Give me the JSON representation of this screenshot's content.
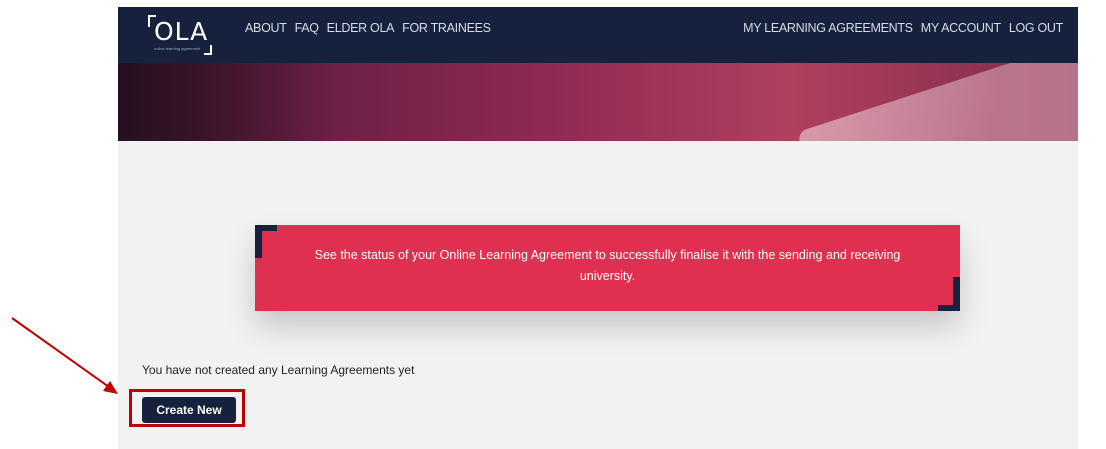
{
  "logo": {
    "text": "OLA",
    "tagline": "online learning agreement"
  },
  "nav_left": [
    "ABOUT",
    "FAQ",
    "ELDER OLA",
    "FOR TRAINEES"
  ],
  "nav_right": [
    "MY LEARNING AGREEMENTS",
    "MY ACCOUNT",
    "LOG OUT"
  ],
  "banner": {
    "text": "See the status of your Online Learning Agreement to successfully finalise it with the sending and receiving university."
  },
  "main": {
    "empty_message": "You have not created any Learning Agreements yet",
    "create_button": "Create New"
  },
  "colors": {
    "navbar": "#16213e",
    "banner": "#e0304f",
    "annotation": "#c00000"
  }
}
